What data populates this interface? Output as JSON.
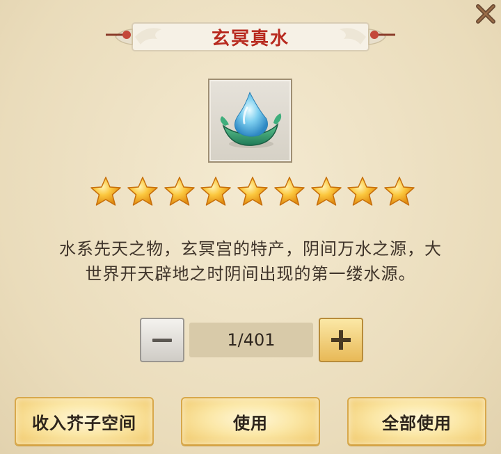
{
  "dialog": {
    "title": "玄冥真水",
    "star_count": 9,
    "description_line1": "水系先天之物，玄冥宫的特产，阴间万水之源，大",
    "description_line2": "世界开天辟地之时阴间出现的第一缕水源。",
    "quantity": "1/401"
  },
  "icons": {
    "close": "close-x-icon",
    "item": "water-drop-leaf-icon",
    "star": "gold-star-icon",
    "minus": "minus-icon",
    "plus": "plus-icon"
  },
  "actions": {
    "store_label": "收入芥子空间",
    "use_label": "使用",
    "use_all_label": "全部使用"
  },
  "colors": {
    "title": "#b82a1f",
    "panel": "#efe3c6",
    "button_gold": "#f0c767",
    "star": "#f5a623"
  }
}
